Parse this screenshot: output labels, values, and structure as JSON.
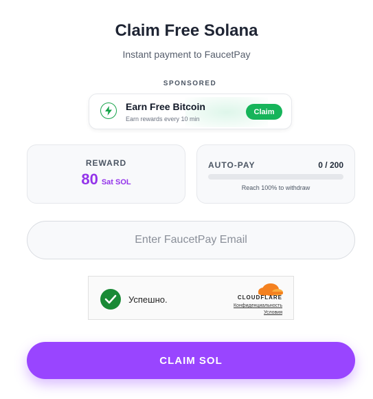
{
  "header": {
    "title": "Claim Free Solana",
    "subtitle": "Instant payment to FaucetPay"
  },
  "sponsored": {
    "label": "SPONSORED",
    "ad_title": "Earn Free Bitcoin",
    "ad_subtitle": "Earn rewards every 10 min",
    "ad_button": "Claim",
    "icon": "lightning-bolt-icon",
    "accent": "#16b45a"
  },
  "reward": {
    "label": "REWARD",
    "value": "80",
    "unit": "Sat SOL",
    "color": "#9333ea"
  },
  "autopay": {
    "label": "AUTO-PAY",
    "count": "0 / 200",
    "progress": 0,
    "note": "Reach 100% to withdraw"
  },
  "email": {
    "placeholder": "Enter FaucetPay Email",
    "value": ""
  },
  "captcha": {
    "status": "Успешно.",
    "brand": "CLOUDFLARE",
    "privacy": "Конфиденциальность",
    "terms": "Условия",
    "icon": "checkmark-icon"
  },
  "claim": {
    "label": "CLAIM SOL",
    "color": "#9945ff"
  }
}
